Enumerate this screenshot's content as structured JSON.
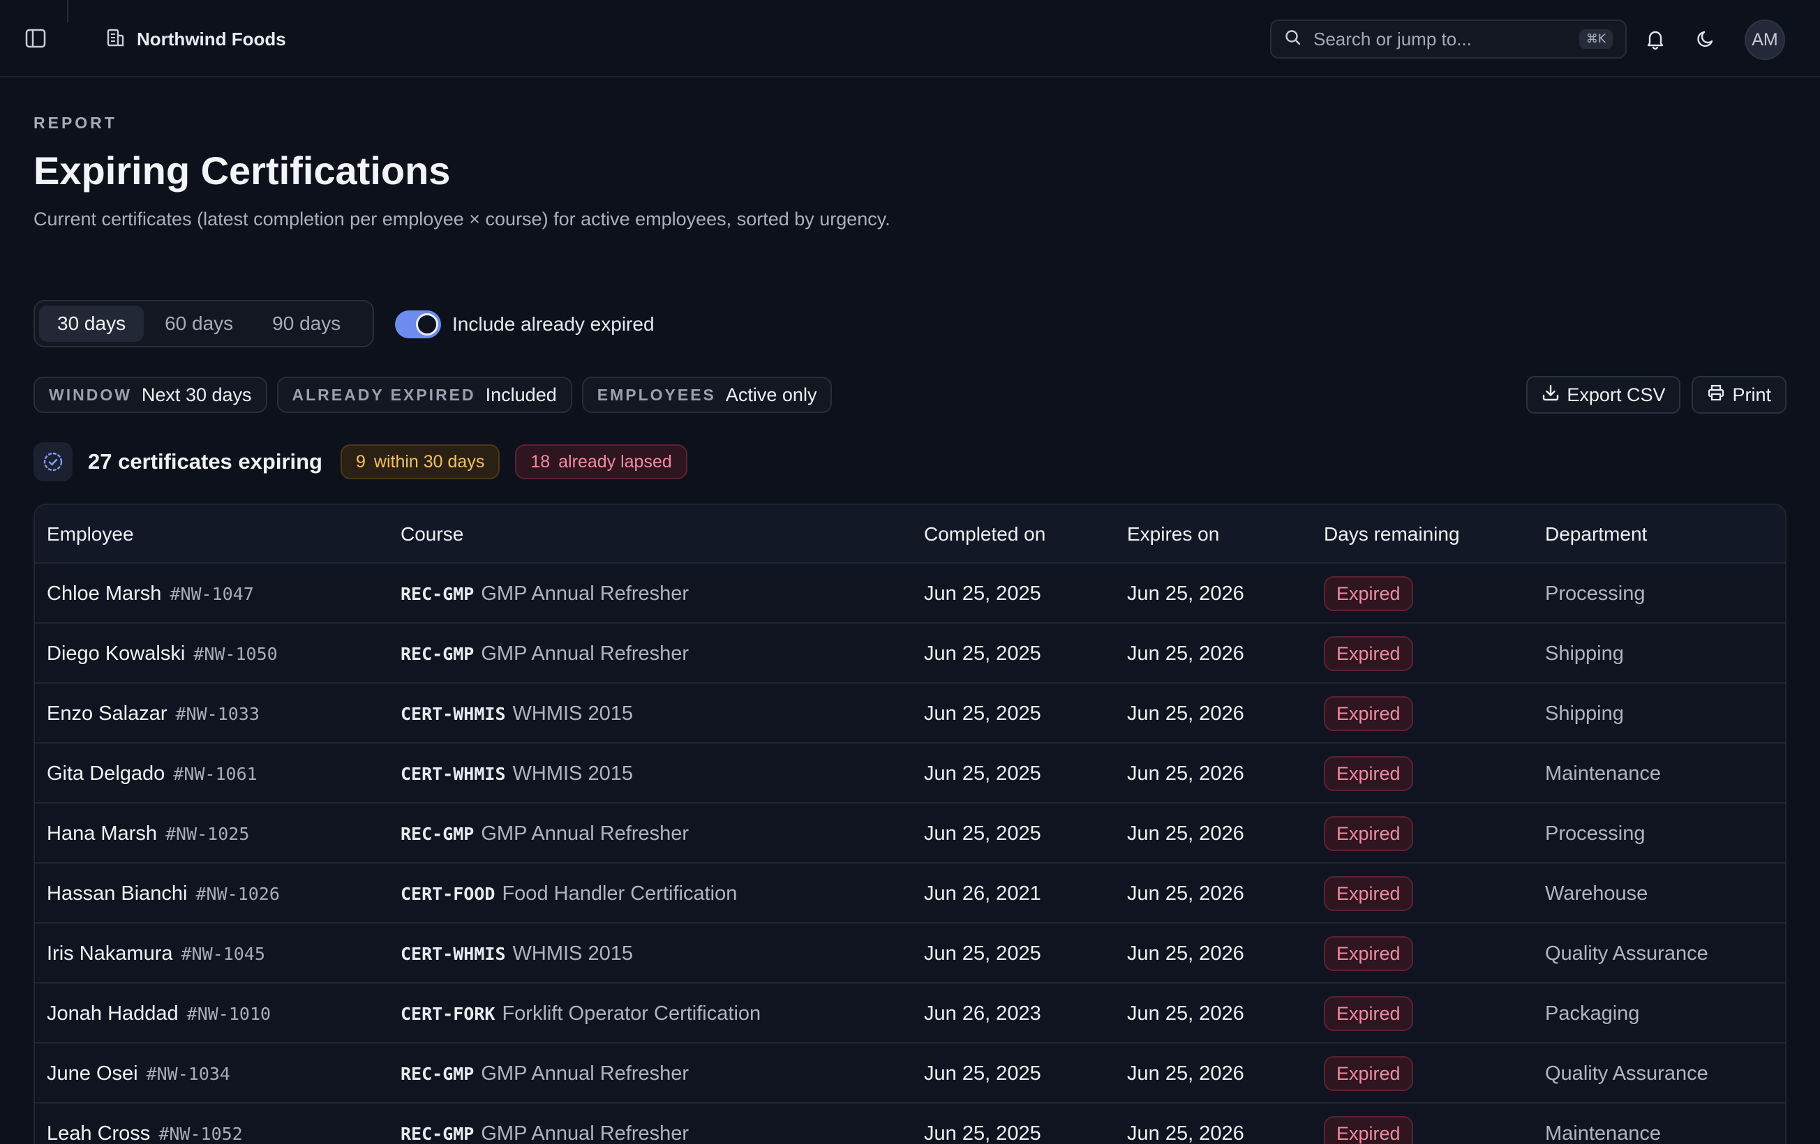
{
  "topbar": {
    "org_name": "Northwind Foods",
    "search_placeholder": "Search or jump to...",
    "search_shortcut": "⌘K",
    "avatar_initials": "AM"
  },
  "header": {
    "eyebrow": "REPORT",
    "title": "Expiring Certifications",
    "subtitle": "Current certificates (latest completion per employee × course) for active employees, sorted by urgency."
  },
  "controls": {
    "windows": [
      {
        "label": "30 days",
        "active": true
      },
      {
        "label": "60 days",
        "active": false
      },
      {
        "label": "90 days",
        "active": false
      }
    ],
    "include_expired_label": "Include already expired",
    "include_expired_on": true
  },
  "filters": [
    {
      "key": "WINDOW",
      "value": "Next 30 days"
    },
    {
      "key": "ALREADY EXPIRED",
      "value": "Included"
    },
    {
      "key": "EMPLOYEES",
      "value": "Active only"
    }
  ],
  "actions": {
    "export_label": "Export CSV",
    "print_label": "Print"
  },
  "summary": {
    "text": "27 certificates expiring",
    "within_count": "9",
    "within_label": "within 30 days",
    "lapsed_count": "18",
    "lapsed_label": "already lapsed"
  },
  "table": {
    "columns": [
      "Employee",
      "Course",
      "Completed on",
      "Expires on",
      "Days remaining",
      "Department"
    ],
    "rows": [
      {
        "name": "Chloe Marsh",
        "id": "#NW-1047",
        "code": "REC-GMP",
        "course": "GMP Annual Refresher",
        "completed": "Jun 25, 2025",
        "expires": "Jun 25, 2026",
        "status": "Expired",
        "dept": "Processing"
      },
      {
        "name": "Diego Kowalski",
        "id": "#NW-1050",
        "code": "REC-GMP",
        "course": "GMP Annual Refresher",
        "completed": "Jun 25, 2025",
        "expires": "Jun 25, 2026",
        "status": "Expired",
        "dept": "Shipping"
      },
      {
        "name": "Enzo Salazar",
        "id": "#NW-1033",
        "code": "CERT-WHMIS",
        "course": "WHMIS 2015",
        "completed": "Jun 25, 2025",
        "expires": "Jun 25, 2026",
        "status": "Expired",
        "dept": "Shipping"
      },
      {
        "name": "Gita Delgado",
        "id": "#NW-1061",
        "code": "CERT-WHMIS",
        "course": "WHMIS 2015",
        "completed": "Jun 25, 2025",
        "expires": "Jun 25, 2026",
        "status": "Expired",
        "dept": "Maintenance"
      },
      {
        "name": "Hana Marsh",
        "id": "#NW-1025",
        "code": "REC-GMP",
        "course": "GMP Annual Refresher",
        "completed": "Jun 25, 2025",
        "expires": "Jun 25, 2026",
        "status": "Expired",
        "dept": "Processing"
      },
      {
        "name": "Hassan Bianchi",
        "id": "#NW-1026",
        "code": "CERT-FOOD",
        "course": "Food Handler Certification",
        "completed": "Jun 26, 2021",
        "expires": "Jun 25, 2026",
        "status": "Expired",
        "dept": "Warehouse"
      },
      {
        "name": "Iris Nakamura",
        "id": "#NW-1045",
        "code": "CERT-WHMIS",
        "course": "WHMIS 2015",
        "completed": "Jun 25, 2025",
        "expires": "Jun 25, 2026",
        "status": "Expired",
        "dept": "Quality Assurance"
      },
      {
        "name": "Jonah Haddad",
        "id": "#NW-1010",
        "code": "CERT-FORK",
        "course": "Forklift Operator Certification",
        "completed": "Jun 26, 2023",
        "expires": "Jun 25, 2026",
        "status": "Expired",
        "dept": "Packaging"
      },
      {
        "name": "June Osei",
        "id": "#NW-1034",
        "code": "REC-GMP",
        "course": "GMP Annual Refresher",
        "completed": "Jun 25, 2025",
        "expires": "Jun 25, 2026",
        "status": "Expired",
        "dept": "Quality Assurance"
      },
      {
        "name": "Leah Cross",
        "id": "#NW-1052",
        "code": "REC-GMP",
        "course": "GMP Annual Refresher",
        "completed": "Jun 25, 2025",
        "expires": "Jun 25, 2026",
        "status": "Expired",
        "dept": "Maintenance"
      }
    ]
  }
}
